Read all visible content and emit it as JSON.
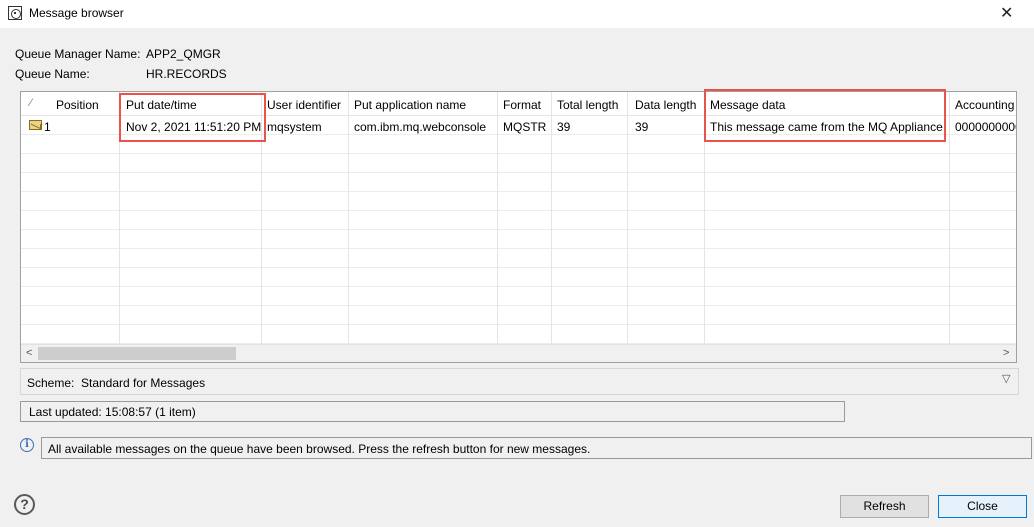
{
  "window": {
    "title": "Message browser",
    "close_glyph": "✕"
  },
  "info": {
    "qm_label": "Queue Manager Name:",
    "qm_value": "APP2_QMGR",
    "queue_label": "Queue Name:",
    "queue_value": "HR.RECORDS"
  },
  "table": {
    "sort_glyph": "⁄",
    "columns": [
      "Position",
      "Put date/time",
      "User identifier",
      "Put application name",
      "Format",
      "Total length",
      "Data length",
      "Message data",
      "Accounting"
    ],
    "rows": [
      {
        "icon": "envelope-icon",
        "position": "1",
        "put_datetime": "Nov 2, 2021 11:51:20 PM",
        "user_identifier": "mqsystem",
        "put_app_name": "com.ibm.mq.webconsole",
        "format": "MQSTR",
        "total_length": "39",
        "data_length": "39",
        "message_data": "This message came from the MQ Appliance",
        "accounting": "0000000000"
      }
    ],
    "scroll_left_glyph": "<",
    "scroll_right_glyph": ">",
    "highlight_color": "#e8544b"
  },
  "scheme": {
    "label": "Scheme:",
    "value": "Standard for Messages",
    "dropdown_glyph": "▽"
  },
  "status": {
    "text": "Last updated: 15:08:57 (1 item)"
  },
  "message": {
    "icon_glyph": "i",
    "text": "All available messages on the queue have been browsed.  Press the refresh button for new messages."
  },
  "footer": {
    "help_glyph": "?",
    "refresh_label": "Refresh",
    "close_label": "Close"
  }
}
